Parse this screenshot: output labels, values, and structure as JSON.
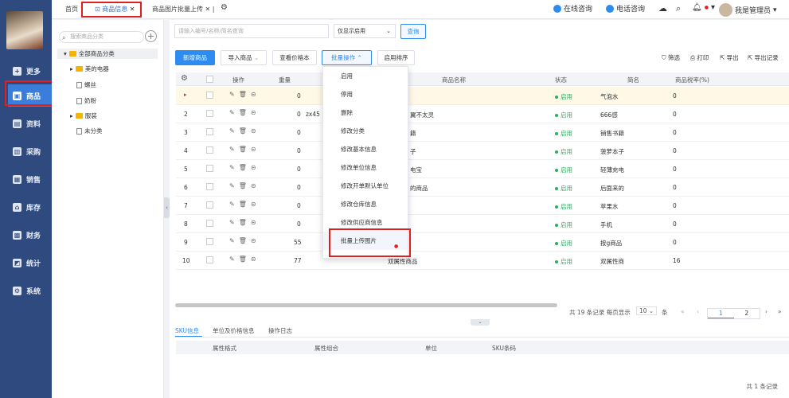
{
  "nav": {
    "items": [
      {
        "label": "更多",
        "icon": "plus-square-icon"
      },
      {
        "label": "商品",
        "icon": "goods-icon"
      },
      {
        "label": "资料",
        "icon": "data-icon"
      },
      {
        "label": "采购",
        "icon": "purchase-icon"
      },
      {
        "label": "销售",
        "icon": "sales-icon"
      },
      {
        "label": "库存",
        "icon": "warehouse-icon"
      },
      {
        "label": "财务",
        "icon": "finance-icon"
      },
      {
        "label": "统计",
        "icon": "stats-icon"
      },
      {
        "label": "系统",
        "icon": "gear-icon"
      }
    ]
  },
  "tabs": {
    "home": "首页",
    "goods": "商品信息",
    "upload": "商品图片批量上传"
  },
  "topbar": {
    "online": "在线咨询",
    "phone": "电话咨询",
    "user": "我是管理员"
  },
  "tree": {
    "search_placeholder": "搜索商品分类",
    "nodes": [
      {
        "label": "全部商品分类"
      },
      {
        "label": "美的电器"
      },
      {
        "label": "螺丝"
      },
      {
        "label": "奶粉"
      },
      {
        "label": "服装"
      },
      {
        "label": "未分类"
      }
    ]
  },
  "filter": {
    "keyword_placeholder": "请输入编号/名称/简名查询",
    "status_value": "仅显示启用",
    "query": "查询"
  },
  "toolbar": {
    "add": "新增商品",
    "import": "导入商品",
    "price": "查看价格本",
    "batch": "批量操作",
    "sort": "启用排序",
    "filter": "筛选",
    "print": "打印",
    "export": "导出",
    "export_log": "导出记录"
  },
  "table": {
    "headers": {
      "ops": "操作",
      "weight": "重量",
      "name": "商品名称",
      "status": "状态",
      "short": "简名",
      "tax": "商品税率(%)"
    },
    "rows": [
      {
        "no": "",
        "weight": "0",
        "code": "",
        "name": "",
        "status": "启用",
        "short": "气泡水",
        "tax": "0"
      },
      {
        "no": "2",
        "weight": "0",
        "code": "zx45",
        "name": "翼不太灵",
        "status": "启用",
        "short": "666感",
        "tax": "0"
      },
      {
        "no": "3",
        "weight": "0",
        "code": "",
        "name": "籍",
        "status": "启用",
        "short": "销售书籍",
        "tax": "0"
      },
      {
        "no": "4",
        "weight": "0",
        "code": "",
        "name": "子",
        "status": "启用",
        "short": "菠萝本子",
        "tax": "0"
      },
      {
        "no": "5",
        "weight": "0",
        "code": "",
        "name": "电宝",
        "status": "启用",
        "short": "轻薄充电",
        "tax": "0"
      },
      {
        "no": "6",
        "weight": "0",
        "code": "",
        "name": "的商品",
        "status": "启用",
        "short": "后面来的",
        "tax": "0"
      },
      {
        "no": "7",
        "weight": "0",
        "code": "",
        "name": "",
        "status": "启用",
        "short": "苹果水",
        "tax": "0"
      },
      {
        "no": "8",
        "weight": "0",
        "code": "",
        "name": "",
        "status": "启用",
        "short": "手机",
        "tax": "0"
      },
      {
        "no": "9",
        "weight": "55",
        "code": "",
        "name": "",
        "status": "启用",
        "short": "按g商品",
        "tax": "0"
      },
      {
        "no": "10",
        "weight": "77",
        "code": "",
        "name": "双属性商品",
        "status": "启用",
        "short": "双属性商",
        "tax": "16"
      }
    ]
  },
  "dropdown": {
    "items": [
      "启用",
      "停用",
      "删除",
      "修改分类",
      "修改基本信息",
      "修改单位信息",
      "修改开单默认单位",
      "修改仓库信息",
      "修改供应商信息",
      "批量上传图片"
    ]
  },
  "pagination": {
    "total": "共 19 条记录 每页显示",
    "size": "10",
    "unit": "条",
    "page1": "1",
    "page2": "2"
  },
  "subtabs": {
    "sku": "SKU信息",
    "unit_price": "单位及价格信息",
    "log": "操作日志"
  },
  "sku": {
    "attr_spec": "属性格式",
    "attr_combo": "属性组合",
    "unit": "单位",
    "code": "SKU条码",
    "total": "共 1 条记录"
  },
  "colors": {
    "nav": "#2f4a7e",
    "active": "#3b7ddb",
    "primary": "#2d8cf0",
    "highlight": "#e02020",
    "status": "#2eae60"
  }
}
